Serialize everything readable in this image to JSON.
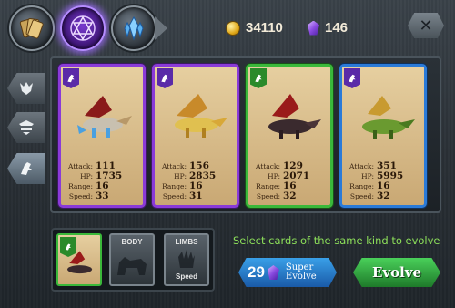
{
  "currency": {
    "coins": "34110",
    "gems": "146"
  },
  "tabs": [
    {
      "icon": "card-deck-icon"
    },
    {
      "icon": "hexagram-icon",
      "active": true
    },
    {
      "icon": "crystal-icon"
    }
  ],
  "side_filters": [
    {
      "icon": "dragon-head-icon"
    },
    {
      "icon": "shield-crest-icon"
    },
    {
      "icon": "dragon-rider-icon",
      "active": true
    }
  ],
  "cards": [
    {
      "rarity": "purple",
      "attack": "111",
      "hp": "1735",
      "range": "16",
      "speed": "33"
    },
    {
      "rarity": "purple",
      "attack": "156",
      "hp": "2835",
      "range": "16",
      "speed": "31"
    },
    {
      "rarity": "green",
      "attack": "129",
      "hp": "2071",
      "range": "16",
      "speed": "32"
    },
    {
      "rarity": "blue",
      "attack": "351",
      "hp": "5995",
      "range": "16",
      "speed": "32"
    }
  ],
  "stat_labels": {
    "attack": "Attack:",
    "hp": "HP:",
    "range": "Range:",
    "speed": "Speed:"
  },
  "slots": {
    "body": "BODY",
    "limbs": "LIMBS",
    "limbs_sub": "Speed"
  },
  "hint": "Select cards of the same kind to evolve",
  "super_evolve": {
    "count": "29",
    "label_line1": "Super",
    "label_line2": "Evolve"
  },
  "evolve_label": "Evolve",
  "colors": {
    "purple": "#8a3ad8",
    "green": "#3ab83a",
    "blue": "#2a7ad8",
    "hint": "#8de05a"
  }
}
